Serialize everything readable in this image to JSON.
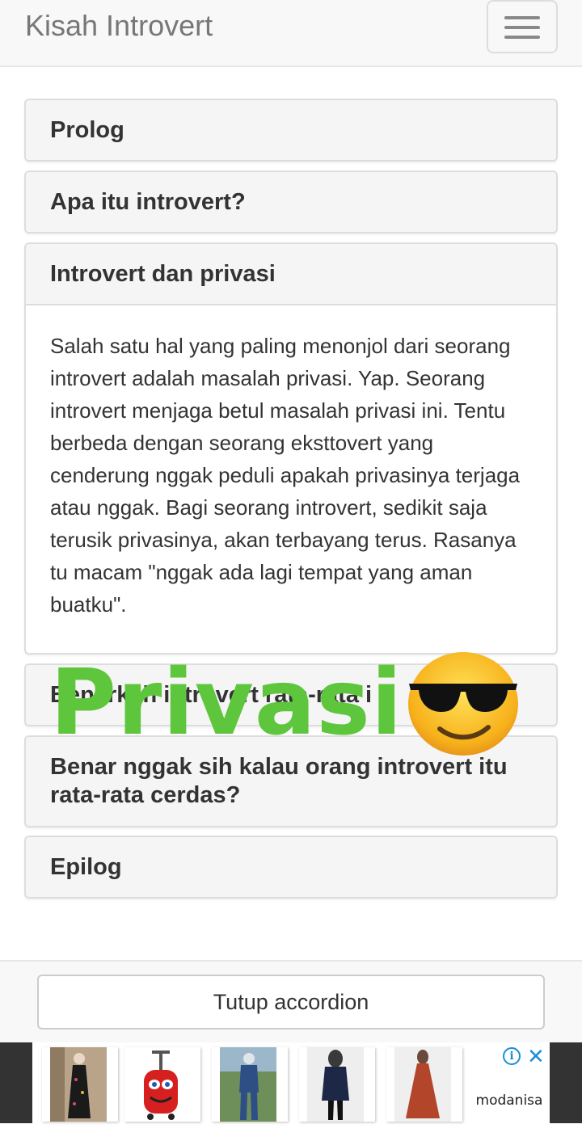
{
  "navbar": {
    "brand": "Kisah Introvert",
    "toggle_icon": "hamburger-menu-icon"
  },
  "accordion": {
    "panels": [
      {
        "title": "Prolog",
        "open": false
      },
      {
        "title": "Apa itu introvert?",
        "open": false
      },
      {
        "title": "Introvert dan privasi",
        "open": true,
        "body": "Salah satu hal yang paling menonjol dari seorang introvert adalah masalah privasi. Yap. Seorang introvert menjaga betul masalah privasi ini. Tentu berbeda dengan seorang eksttovert yang cenderung nggak peduli apakah privasinya terjaga atau nggak. Bagi seorang introvert, sedikit saja terusik privasinya, akan terbayang terus. Rasanya tu macam \"nggak ada lagi tempat yang aman buatku\"."
      },
      {
        "title": "Benarkah introvert rata-rata i",
        "open": false
      },
      {
        "title": "Benar nggak sih kalau orang introvert itu rata-rata cerdas?",
        "open": false
      },
      {
        "title": "Epilog",
        "open": false
      }
    ]
  },
  "overlay": {
    "text": "Privasi",
    "emoji_icon": "sunglasses-face-emoji",
    "color": "#5ec63d"
  },
  "footer": {
    "close_button": "Tutup accordion"
  },
  "ad": {
    "brand": "modanisa",
    "info_icon": "info-icon",
    "close_icon": "close-icon",
    "items": [
      "floral-dress-product",
      "kids-backpack-product",
      "denim-set-product",
      "navy-tunic-product",
      "rust-dress-product"
    ]
  }
}
